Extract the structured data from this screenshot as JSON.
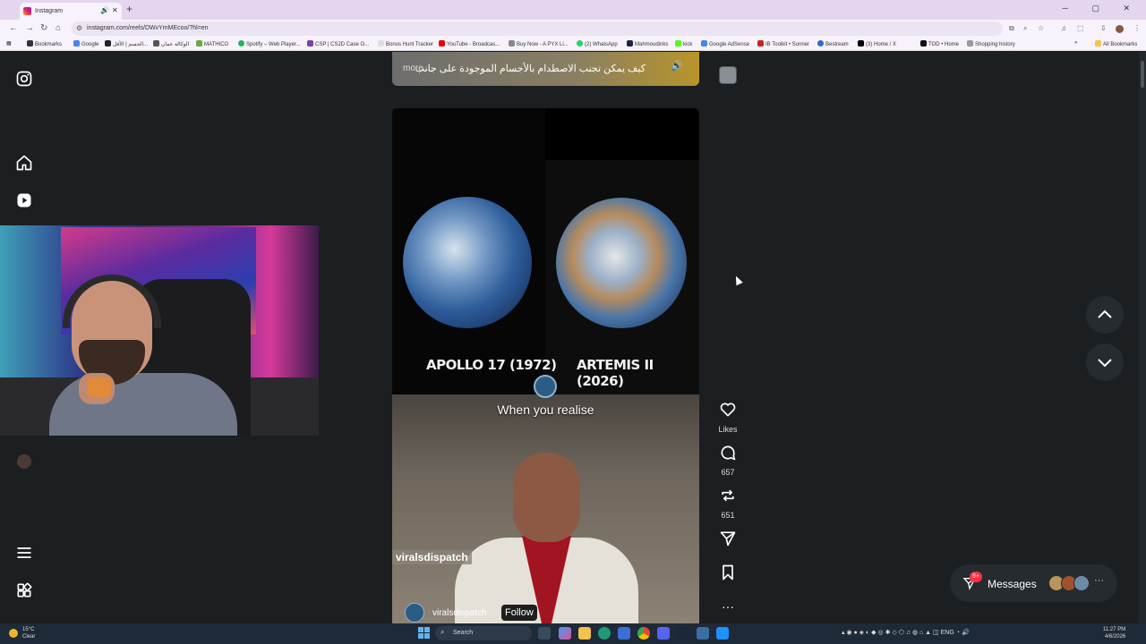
{
  "browser": {
    "tab_title": "Instagram",
    "url": "instagram.com/reels/DWvYmMEcoo/?hl=en",
    "bookmarks": [
      {
        "label": "Bookmarks",
        "color": "#333"
      },
      {
        "label": "Google",
        "color": "#4285f4"
      },
      {
        "label": "الحسم | الأقل...",
        "color": "#222"
      },
      {
        "label": "الوكالة عمان",
        "color": "#555"
      },
      {
        "label": "MATHICO",
        "color": "#6a4"
      },
      {
        "label": "Spotify – Web Player...",
        "color": "#1db954"
      },
      {
        "label": "CSP | CS2D Case O...",
        "color": "#7b3fb0"
      },
      {
        "label": "Bonus Hunt Tracker",
        "color": "#ddd"
      },
      {
        "label": "YouTube - Broadcas...",
        "color": "#e00"
      },
      {
        "label": "Buy Now - A PYX Li...",
        "color": "#888"
      },
      {
        "label": "(2) WhatsApp",
        "color": "#25d366"
      },
      {
        "label": "Mahmoudinks",
        "color": "#224"
      },
      {
        "label": "kick",
        "color": "#53fc18"
      },
      {
        "label": "Google AdSense",
        "color": "#4285f4"
      },
      {
        "label": "IB Toolkit • Sonner",
        "color": "#c22"
      },
      {
        "label": "Bestream",
        "color": "#2a6ad8"
      },
      {
        "label": "(3) Home / X",
        "color": "#000"
      },
      {
        "label": "TOD • Home",
        "color": "#111"
      },
      {
        "label": "Shopping history",
        "color": "#999"
      }
    ],
    "all_bookmarks": "All Bookmarks"
  },
  "sidebar": {
    "icons": [
      "instagram-logo-icon",
      "home-icon",
      "reels-icon",
      "menu-icon",
      "apps-icon"
    ]
  },
  "reel_top": {
    "caption": "كيف يمكن تجنب الاصطدام بالأجسام الموجودة على جانب",
    "more": "more ..."
  },
  "reel": {
    "label_left": "APOLLO 17 (1972)",
    "label_right": "ARTEMIS II (2026)",
    "meme_text": "When you realise",
    "watermark": "viralsdispatch",
    "username": "viralsdispatch",
    "follow": "Follow"
  },
  "actions": {
    "likes": "Likes",
    "comments": "657",
    "reposts": "651"
  },
  "messages": {
    "label": "Messages",
    "badge": "9+",
    "more": "···"
  },
  "taskbar": {
    "temperature": "15°C",
    "condition": "Clear",
    "search": "Search",
    "lang": "ENG",
    "time": "11:27 PM",
    "date": "4/6/2026"
  }
}
